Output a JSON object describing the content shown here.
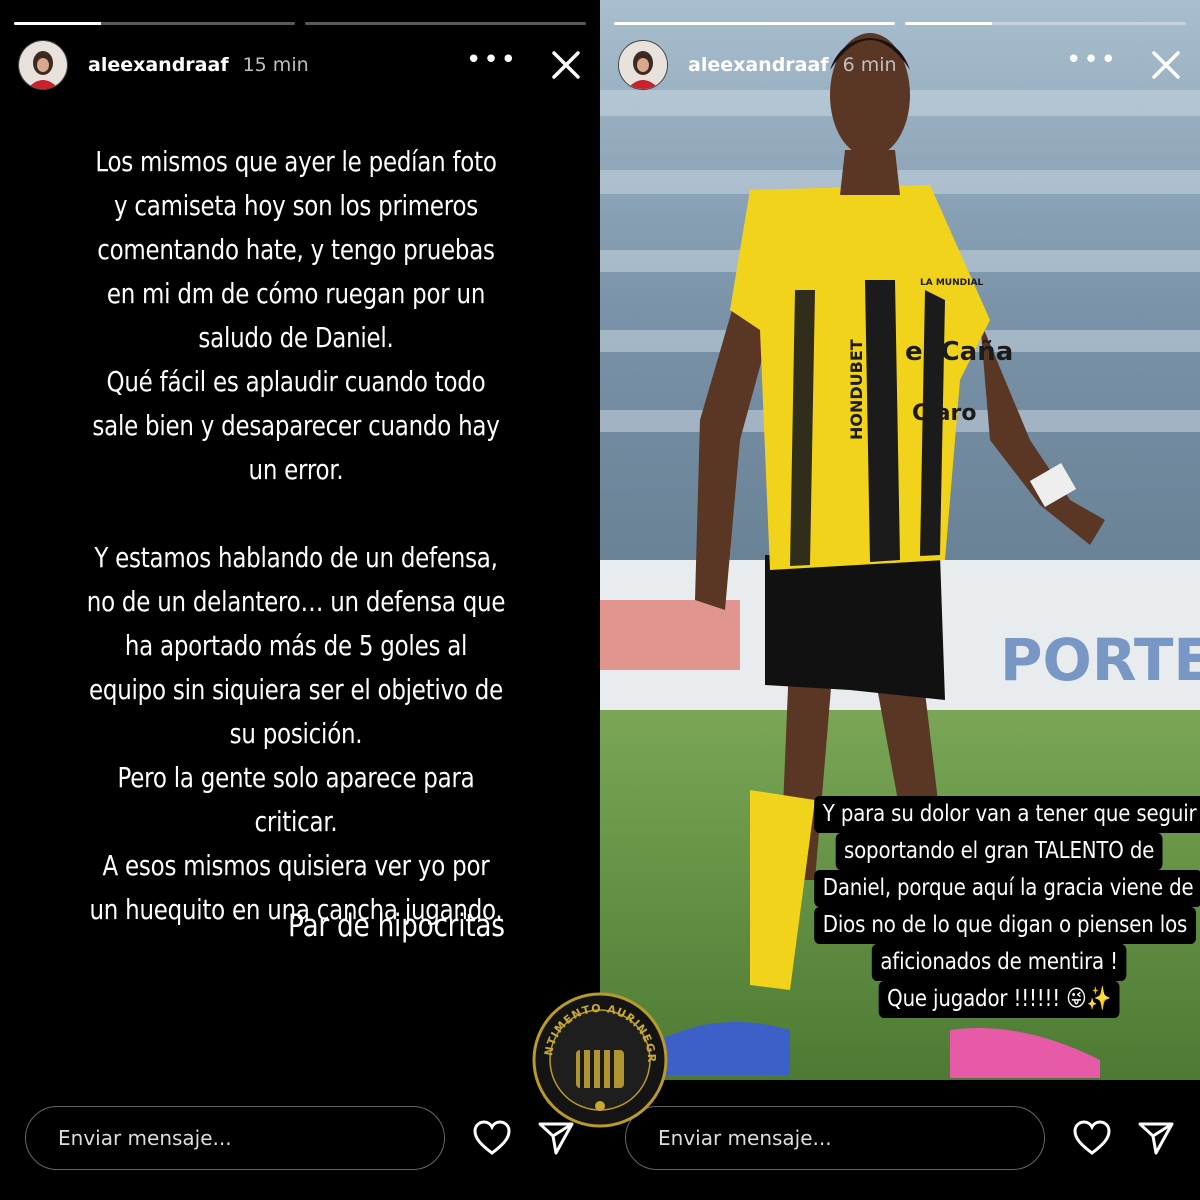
{
  "left_story": {
    "username": "aleexandraaf",
    "time": "15 min",
    "more_icon": "more-horizontal-icon",
    "close_icon": "close-icon",
    "progress": [
      0.31,
      0.0
    ],
    "text_paragraphs": [
      "Los mismos que ayer le pedían foto y camiseta hoy son los primeros comentando hate, y tengo pruebas en mi dm de cómo ruegan por un saludo de Daniel.",
      "Qué fácil es aplaudir cuando todo sale bien y desaparecer cuando hay un error.",
      "",
      "Y estamos hablando de un defensa, no de un delantero… un defensa que ha aportado más de 5 goles al equipo sin siquiera ser el objetivo de su posición.",
      "Pero la gente solo aparece para criticar.",
      "A esos mismos quisiera ver yo por un huequito en una cancha jugando."
    ],
    "signature": "Par de hipocritas",
    "message_placeholder": "Enviar mensaje...",
    "heart_icon": "heart-icon",
    "send_icon": "send-icon"
  },
  "right_story": {
    "username": "aleexandraaf",
    "time": "6 min",
    "more_icon": "more-horizontal-icon",
    "close_icon": "close-icon",
    "progress": [
      1.0,
      0.31
    ],
    "photo": {
      "jersey_sponsor_1": "el Caña",
      "jersey_sponsor_2": "Claro",
      "jersey_side_text": "HONDUBET",
      "jersey_top_text": "LA MUNDIAL"
    },
    "caption_lines": [
      "Y para su dolor van a tener que seguir",
      "soportando el gran TALENTO de",
      "Daniel, porque aquí la gracia viene de",
      "Dios no de lo que digan o piensen los",
      "aficionados de mentira !",
      "Que jugador !!!!!! 😜✨"
    ],
    "message_placeholder": "Enviar mensaje...",
    "heart_icon": "heart-icon",
    "send_icon": "send-icon"
  },
  "watermark": {
    "text": "SENTIMENTO AURINEGRO"
  }
}
